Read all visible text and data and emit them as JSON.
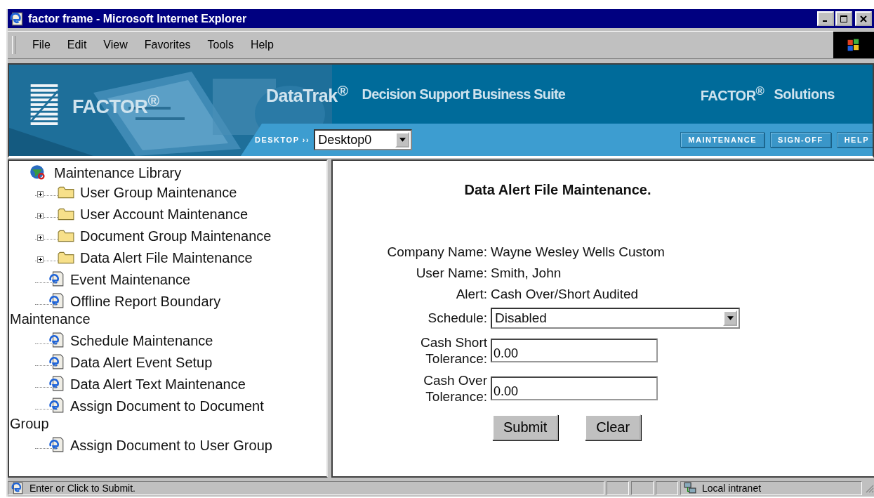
{
  "window": {
    "title": "factor frame - Microsoft Internet Explorer"
  },
  "menu": [
    "File",
    "Edit",
    "View",
    "Favorites",
    "Tools",
    "Help"
  ],
  "banner": {
    "logo": "FACTOR$^{®}$",
    "product": "DataTrak$^{®}$",
    "tagline": "Decision Support Business Suite",
    "brand": "FACTOR$^{®}$",
    "brand_suffix": "Solutions",
    "desktop_label": "DESKTOP ››",
    "desktop_select": "Desktop0",
    "nav_buttons": [
      "MAINTENANCE",
      "SIGN-OFF",
      "HELP"
    ]
  },
  "tree": {
    "root": "Maintenance Library",
    "children": [
      {
        "kind": "folder",
        "label": "User Group Maintenance",
        "expanded": false
      },
      {
        "kind": "folder",
        "label": "User Account Maintenance",
        "expanded": false
      },
      {
        "kind": "folder",
        "label": "Document Group Maintenance",
        "expanded": false
      },
      {
        "kind": "folder",
        "label": "Data Alert File Maintenance",
        "expanded": false
      },
      {
        "kind": "page",
        "label": "Event Maintenance"
      },
      {
        "kind": "page",
        "label": "Offline Report Boundary",
        "continuation": "Maintenance"
      },
      {
        "kind": "page",
        "label": "Schedule Maintenance"
      },
      {
        "kind": "page",
        "label": "Data Alert Event Setup"
      },
      {
        "kind": "page",
        "label": "Data Alert Text Maintenance"
      },
      {
        "kind": "page",
        "label": "Assign Document to Document",
        "continuation": "Group"
      },
      {
        "kind": "page",
        "label": "Assign Document to User Group"
      }
    ]
  },
  "form": {
    "heading": "Data Alert File Maintenance.",
    "rows": [
      {
        "kind": "text",
        "label": "Company Name:",
        "value": "Wayne Wesley Wells Custom"
      },
      {
        "kind": "text",
        "label": "User Name:",
        "value": "Smith, John"
      },
      {
        "kind": "text",
        "label": "Alert:",
        "value": "Cash Over/Short Audited"
      },
      {
        "kind": "select",
        "label": "Schedule:",
        "value": "Disabled"
      },
      {
        "kind": "input",
        "label": "Cash Short Tolerance:",
        "value": "0.00"
      },
      {
        "kind": "input",
        "label": "Cash Over Tolerance:",
        "value": "0.00"
      }
    ],
    "buttons": [
      "Submit",
      "Clear"
    ]
  },
  "status_bar": {
    "message": "Enter or Click to Submit.",
    "zone": "Local intranet"
  }
}
